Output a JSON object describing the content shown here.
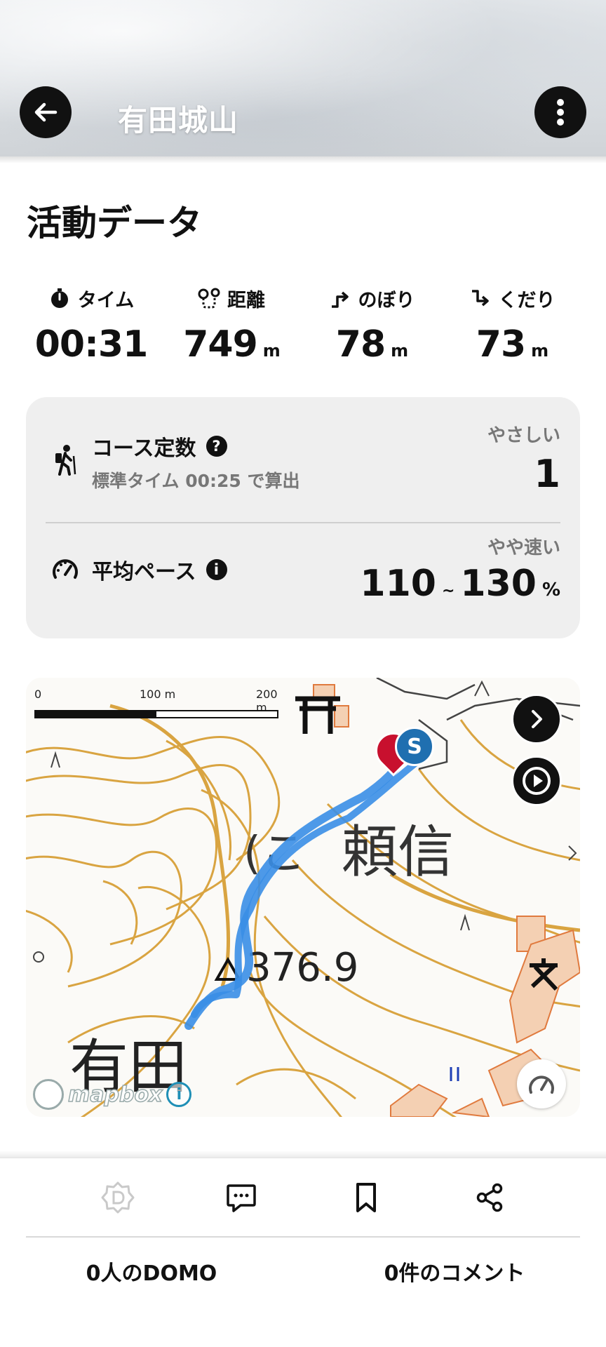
{
  "header": {
    "title": "有田城山"
  },
  "section_title": "活動データ",
  "stats": [
    {
      "label": "タイム",
      "value": "00:31",
      "unit": "",
      "icon": "stopwatch-icon"
    },
    {
      "label": "距離",
      "value": "749",
      "unit": "m",
      "icon": "route-icon"
    },
    {
      "label": "のぼり",
      "value": "78",
      "unit": "m",
      "icon": "ascent-icon"
    },
    {
      "label": "くだり",
      "value": "73",
      "unit": "m",
      "icon": "descent-icon"
    }
  ],
  "course": {
    "title": "コース定数",
    "help_icon": "?",
    "subtitle": "標準タイム 00:25 で算出",
    "difficulty_label": "やさしい",
    "value": "1"
  },
  "pace": {
    "title": "平均ペース",
    "info_icon": "i",
    "speed_label": "やや速い",
    "min": "110",
    "tilde": "~",
    "max": "130",
    "unit": "%"
  },
  "map": {
    "scale_labels": [
      "0",
      "100 m",
      "200 m"
    ],
    "labels": {
      "yorinobu": "頼信",
      "elevation": "376.9",
      "arita": "有田",
      "ri": "(こ"
    },
    "start_marker": "S",
    "attribution": "mapbox"
  },
  "actions": {
    "domo_count": "0人のDOMO",
    "comment_count": "0件のコメント"
  },
  "colors": {
    "route": "#3a8ee6",
    "contour": "#d9a441",
    "card_bg": "#efefef"
  }
}
